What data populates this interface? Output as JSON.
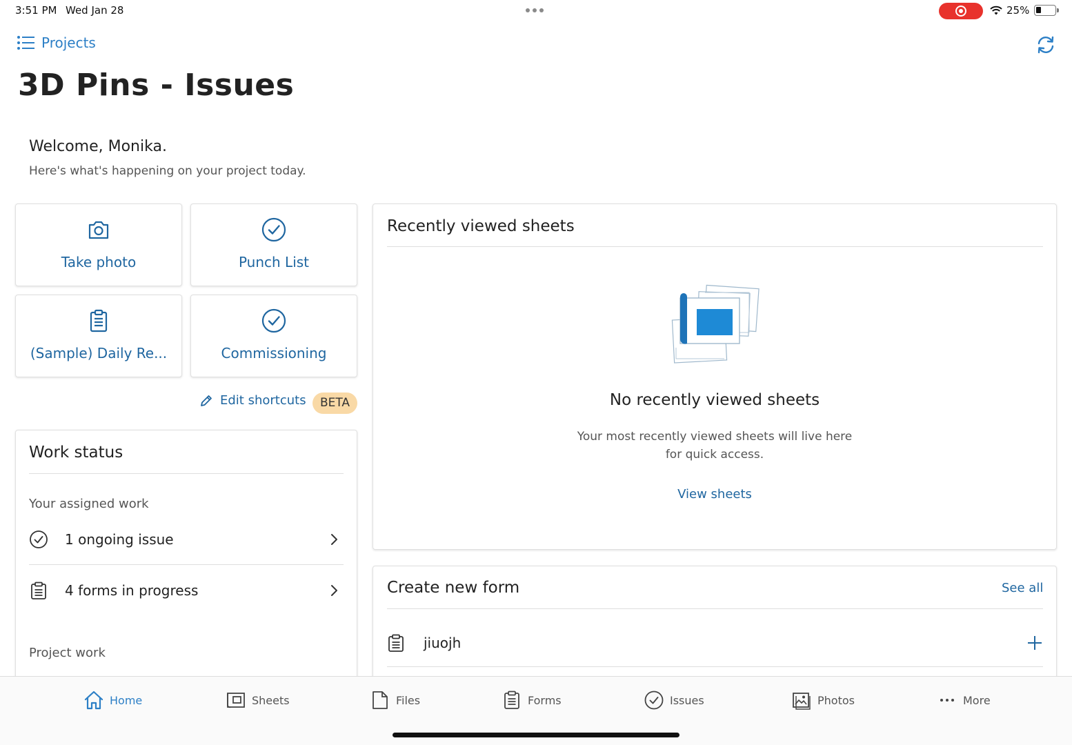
{
  "status_bar": {
    "time": "3:51 PM",
    "date": "Wed Jan 28",
    "battery": "25%",
    "battery_level": 0.25
  },
  "header": {
    "back_label": "Projects",
    "title": "3D Pins - Issues"
  },
  "welcome": {
    "greeting": "Welcome, Monika.",
    "subtitle": "Here's what's happening on your project today."
  },
  "shortcuts": [
    {
      "label": "Take photo",
      "icon": "camera-icon"
    },
    {
      "label": "Punch List",
      "icon": "check-circle-icon"
    },
    {
      "label": "(Sample) Daily Re...",
      "icon": "clipboard-icon"
    },
    {
      "label": "Commissioning",
      "icon": "check-circle-icon"
    }
  ],
  "edit_shortcuts": {
    "label": "Edit shortcuts",
    "badge": "BETA"
  },
  "work_status": {
    "title": "Work status",
    "assigned_label": "Your assigned work",
    "rows": [
      {
        "label": "1 ongoing issue",
        "icon": "check-circle-icon"
      },
      {
        "label": "4 forms in progress",
        "icon": "clipboard-icon"
      }
    ],
    "project_label": "Project work"
  },
  "recent_sheets": {
    "title": "Recently viewed sheets",
    "empty_title": "No recently viewed sheets",
    "empty_subtitle": "Your most recently viewed sheets will live here for quick access.",
    "link": "View sheets"
  },
  "create_form": {
    "title": "Create new form",
    "see_all": "See all",
    "items": [
      {
        "name": "jiuojh"
      }
    ]
  },
  "tabs": [
    {
      "label": "Home",
      "icon": "home-icon",
      "active": true
    },
    {
      "label": "Sheets",
      "icon": "sheets-icon",
      "active": false
    },
    {
      "label": "Files",
      "icon": "file-icon",
      "active": false
    },
    {
      "label": "Forms",
      "icon": "clipboard-icon",
      "active": false
    },
    {
      "label": "Issues",
      "icon": "check-circle-icon",
      "active": false
    },
    {
      "label": "Photos",
      "icon": "photo-icon",
      "active": false
    },
    {
      "label": "More",
      "icon": "more-icon",
      "active": false
    }
  ],
  "colors": {
    "accent": "#2c7fc6",
    "link": "#1f66a0",
    "beta_bg": "#f9d9a6",
    "record": "#e8322c"
  }
}
